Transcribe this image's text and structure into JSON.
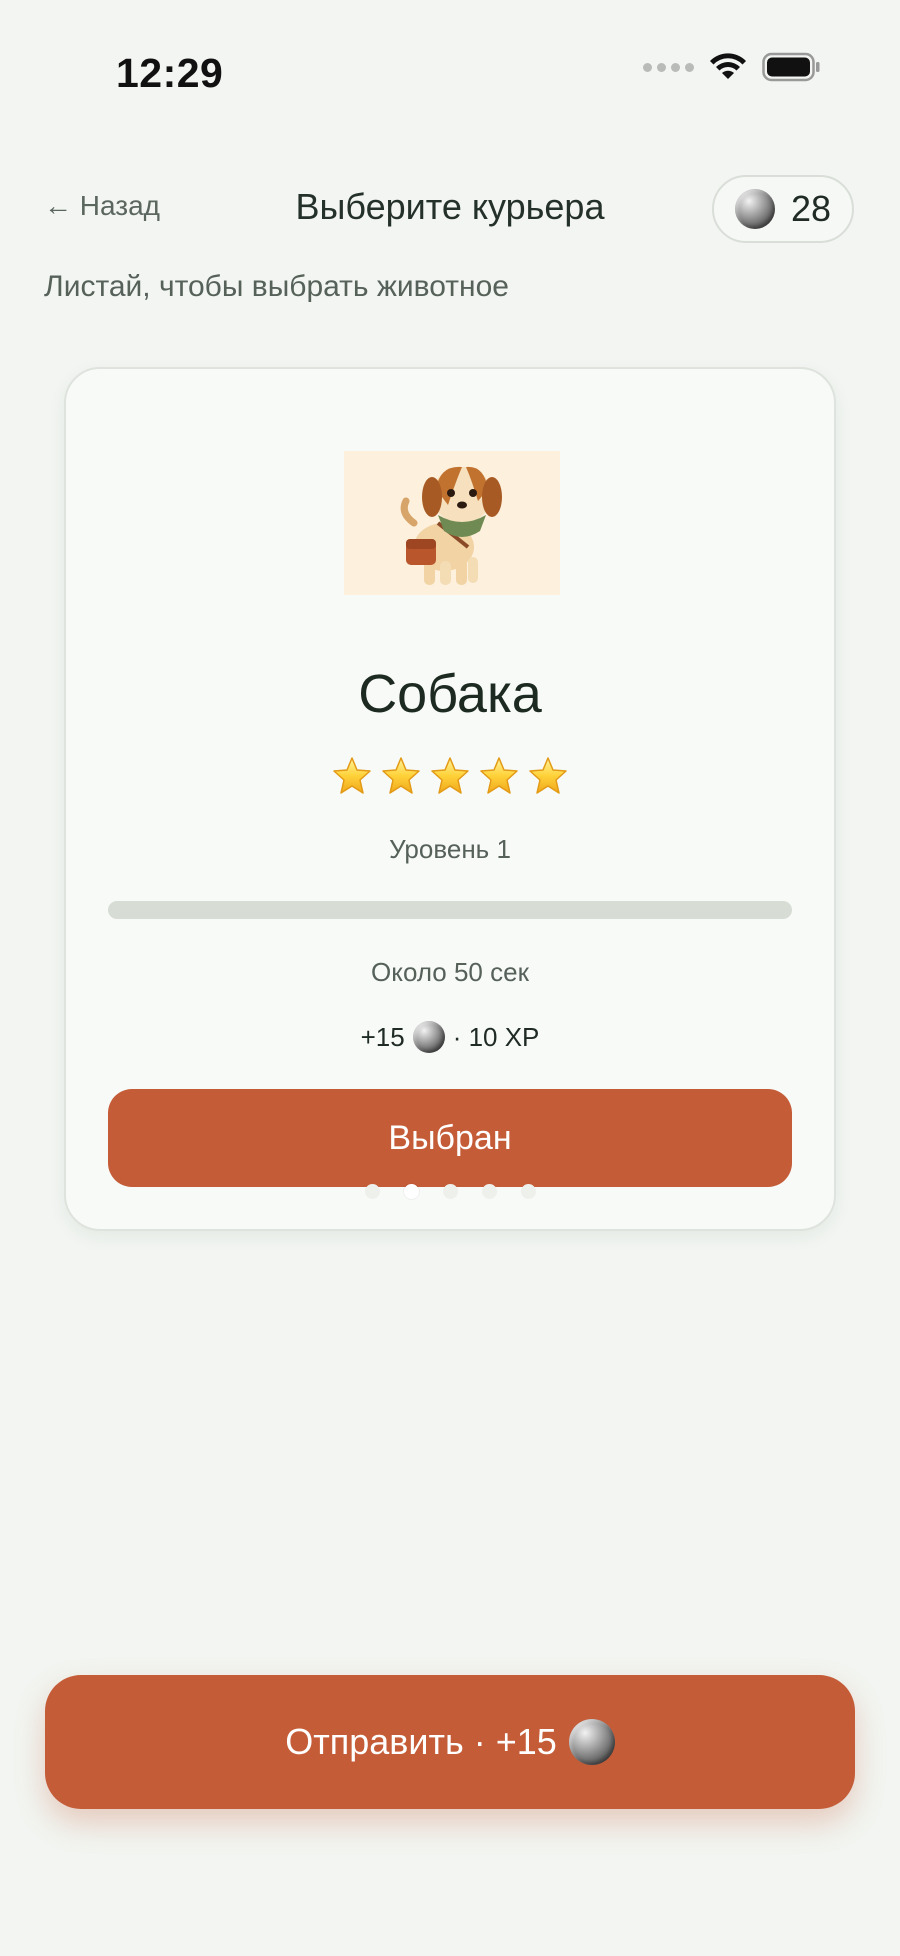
{
  "status_bar": {
    "time": "12:29"
  },
  "header": {
    "back_label": "← Назад",
    "title": "Выберите курьера",
    "coins": "28"
  },
  "subtitle": "Листай, чтобы выбрать животное",
  "card": {
    "pet_image_icon": "dog-courier-illustration",
    "name": "Собака",
    "stars_count": 5,
    "level": "Уровень 1",
    "progress": 0,
    "eta": "Около 50 сек",
    "reward_coins": "+15",
    "reward_xp": "· 10 XP",
    "button_label": "Выбран",
    "pager_count": 5,
    "pager_active": 1
  },
  "send_button": {
    "label": "Отправить · +15"
  },
  "colors": {
    "accent": "#c55c38",
    "background": "#f2f5f1",
    "card": "#f8faf7",
    "track": "#d7ddd5"
  }
}
